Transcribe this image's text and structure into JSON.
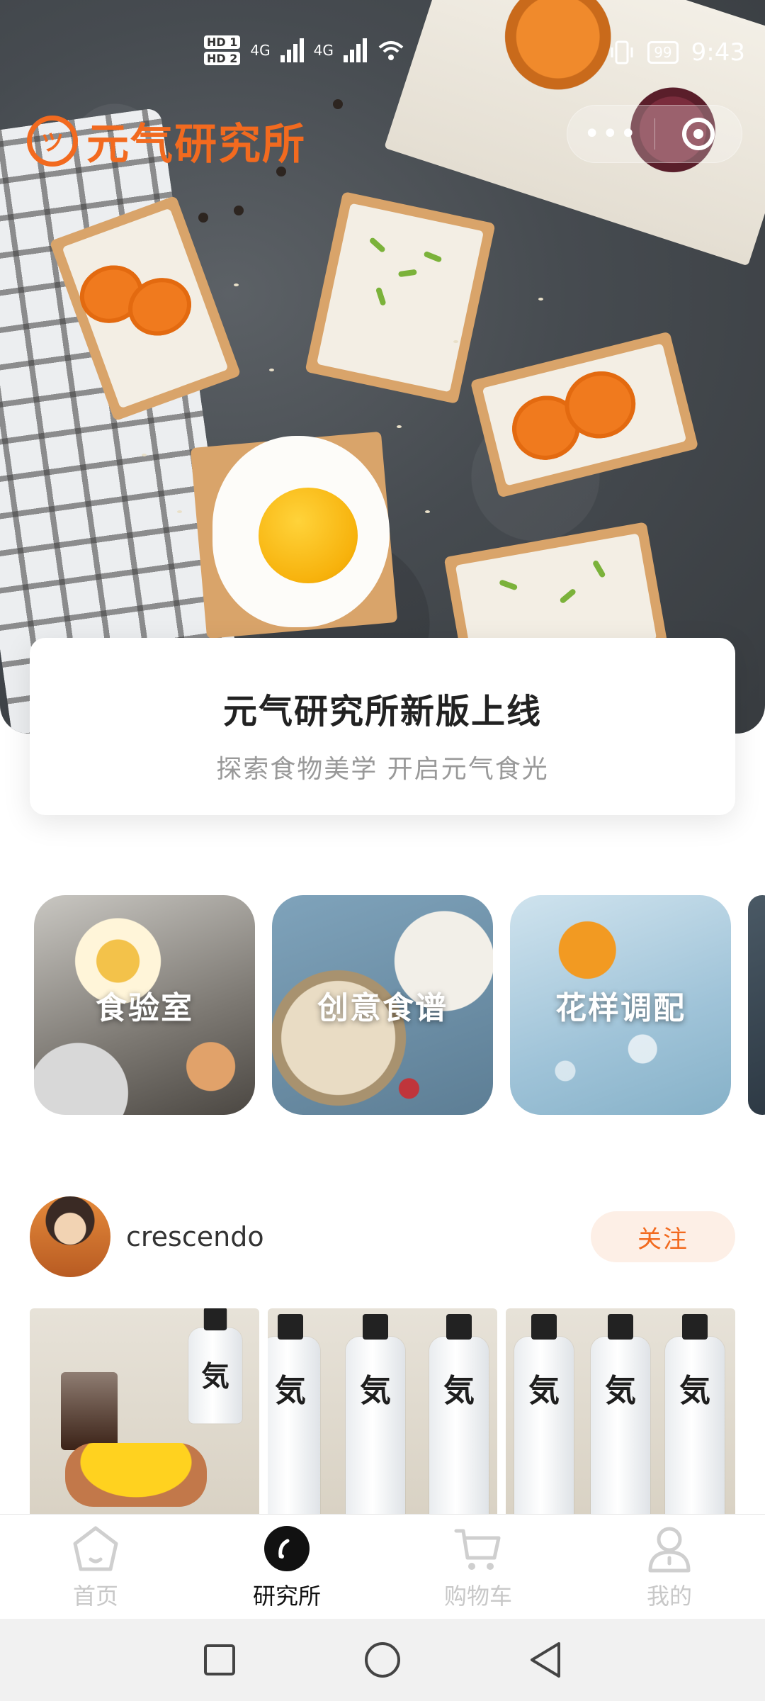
{
  "status_bar": {
    "hd1": "HD 1",
    "hd2": "HD 2",
    "net1": "4G",
    "net2": "4G",
    "battery": "99",
    "time": "9:43"
  },
  "header": {
    "logo_text": "元气研究所",
    "more_label": "•••"
  },
  "announcement": {
    "title": "元气研究所新版上线",
    "subtitle": "探索食物美学 开启元气食光"
  },
  "categories": [
    {
      "label": "食验室"
    },
    {
      "label": "创意食谱"
    },
    {
      "label": "花样调配"
    }
  ],
  "post": {
    "username": "crescendo",
    "follow_label": "关注",
    "bottle_brand": "気"
  },
  "tabbar": {
    "items": [
      {
        "label": "首页",
        "icon": "home-icon",
        "active": false
      },
      {
        "label": "研究所",
        "icon": "lab-icon",
        "active": true
      },
      {
        "label": "购物车",
        "icon": "cart-icon",
        "active": false
      },
      {
        "label": "我的",
        "icon": "profile-icon",
        "active": false
      }
    ]
  },
  "colors": {
    "brand": "#f26a1f",
    "follow_bg": "#fdefe6",
    "inactive_tab": "#c8c8c8",
    "active_tab": "#111111"
  }
}
